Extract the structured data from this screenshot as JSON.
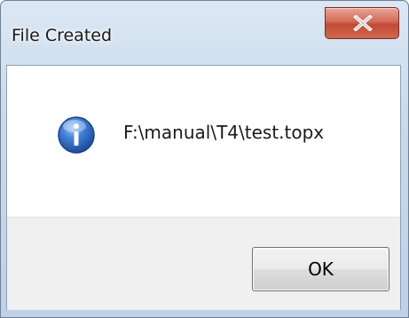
{
  "window": {
    "title": "File Created"
  },
  "titlebar": {
    "close_icon": "close-icon",
    "close_glyph": "X"
  },
  "dialog": {
    "icon": "info-icon",
    "message": "F:\\manual\\T4\\test.topx"
  },
  "buttons": {
    "ok_label": "OK"
  },
  "colors": {
    "close_button": "#c9553f",
    "info_icon": "#2f6fd0",
    "button_area": "#f0f0f0"
  }
}
